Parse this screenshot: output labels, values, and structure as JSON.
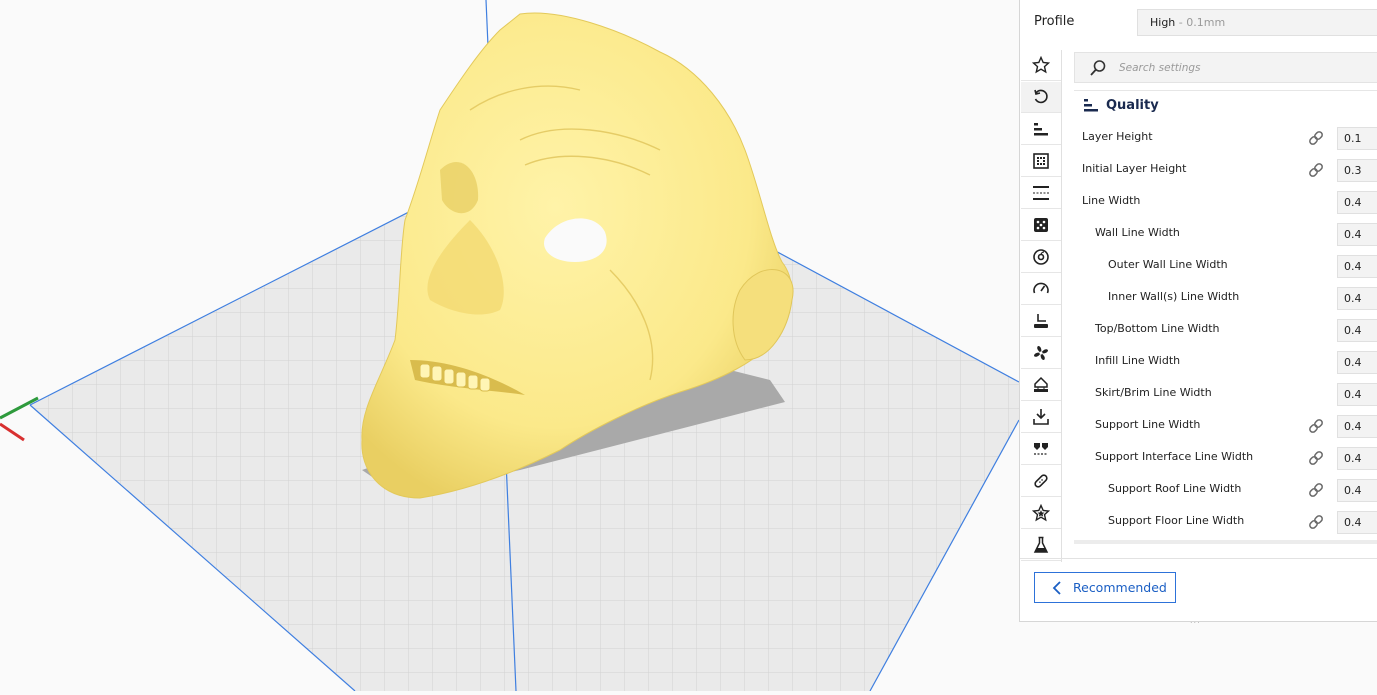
{
  "profile": {
    "label": "Profile",
    "value_main": "High",
    "value_sub": " - 0.1mm"
  },
  "search": {
    "placeholder": "Search settings",
    "icon": "search-icon"
  },
  "categories": [
    {
      "icon": "star-outline-icon",
      "active": false
    },
    {
      "icon": "reset-icon",
      "active": true
    },
    {
      "icon": "quality-icon",
      "active": false
    },
    {
      "icon": "walls-icon",
      "active": false
    },
    {
      "icon": "top-bottom-icon",
      "active": false
    },
    {
      "icon": "infill-icon",
      "active": false
    },
    {
      "icon": "material-icon",
      "active": false
    },
    {
      "icon": "speed-icon",
      "active": false
    },
    {
      "icon": "travel-icon",
      "active": false
    },
    {
      "icon": "cooling-icon",
      "active": false
    },
    {
      "icon": "support-icon",
      "active": false
    },
    {
      "icon": "adhesion-icon",
      "active": false
    },
    {
      "icon": "dual-extrusion-icon",
      "active": false
    },
    {
      "icon": "mesh-fixes-icon",
      "active": false
    },
    {
      "icon": "special-modes-icon",
      "active": false
    },
    {
      "icon": "experimental-icon",
      "active": false
    }
  ],
  "section": {
    "title": "Quality",
    "icon": "quality-icon"
  },
  "settings": [
    {
      "label": "Layer Height",
      "value": "0.1",
      "indent": 0,
      "linked": true
    },
    {
      "label": "Initial Layer Height",
      "value": "0.3",
      "indent": 0,
      "linked": true
    },
    {
      "label": "Line Width",
      "value": "0.4",
      "indent": 0,
      "linked": false
    },
    {
      "label": "Wall Line Width",
      "value": "0.4",
      "indent": 1,
      "linked": false
    },
    {
      "label": "Outer Wall Line Width",
      "value": "0.4",
      "indent": 2,
      "linked": false
    },
    {
      "label": "Inner Wall(s) Line Width",
      "value": "0.4",
      "indent": 2,
      "linked": false
    },
    {
      "label": "Top/Bottom Line Width",
      "value": "0.4",
      "indent": 1,
      "linked": false
    },
    {
      "label": "Infill Line Width",
      "value": "0.4",
      "indent": 1,
      "linked": false
    },
    {
      "label": "Skirt/Brim Line Width",
      "value": "0.4",
      "indent": 1,
      "linked": false
    },
    {
      "label": "Support Line Width",
      "value": "0.4",
      "indent": 1,
      "linked": true
    },
    {
      "label": "Support Interface Line Width",
      "value": "0.4",
      "indent": 1,
      "linked": true
    },
    {
      "label": "Support Roof Line Width",
      "value": "0.4",
      "indent": 2,
      "linked": true
    },
    {
      "label": "Support Floor Line Width",
      "value": "0.4",
      "indent": 2,
      "linked": true
    }
  ],
  "footer": {
    "recommended_label": "Recommended",
    "grip": "..."
  },
  "colors": {
    "model": "#fbe98a",
    "accent": "#2d72d9",
    "build_plate": "#e9e9e9",
    "axis_blue": "#3f7fe0",
    "axis_red": "#d83030",
    "axis_green": "#2e9a3c"
  }
}
